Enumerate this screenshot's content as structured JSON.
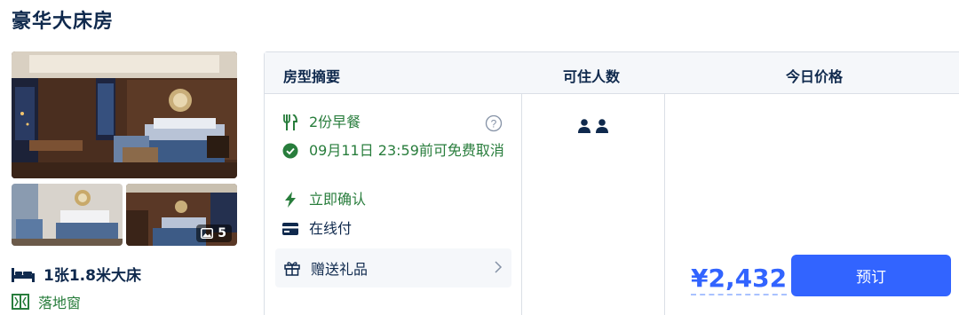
{
  "room": {
    "title": "豪华大床房",
    "photo_count": "5",
    "bed": "1张1.8米大床",
    "feature": "落地窗"
  },
  "table": {
    "headers": {
      "summary": "房型摘要",
      "occupancy": "可住人数",
      "price": "今日价格"
    },
    "perks": {
      "breakfast": "2份早餐",
      "cancel": "09月11日 23:59前可免费取消",
      "confirm": "立即确认",
      "payment": "在线付",
      "gift": "赠送礼品"
    },
    "occupancy_count": 2,
    "price": "¥2,432",
    "book_label": "预订"
  },
  "colors": {
    "accent": "#3264ff",
    "green": "#287d3c",
    "text": "#0f294d",
    "header_bg": "#f5f7fa"
  }
}
